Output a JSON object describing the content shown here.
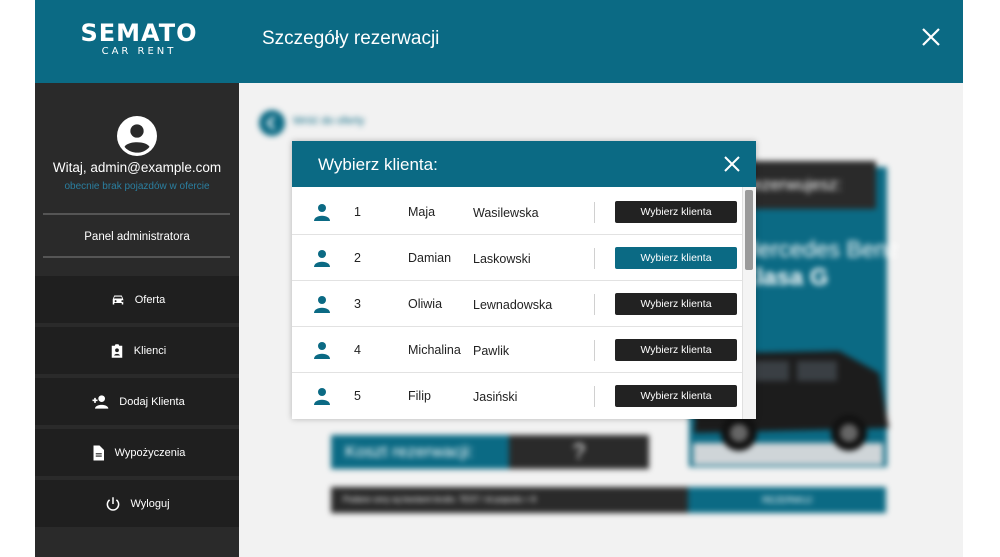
{
  "app": {
    "logo_main": "SEMATO",
    "logo_sub": "CAR RENT",
    "page_title": "Szczegóły rezerwacji"
  },
  "sidebar": {
    "welcome": "Witaj, admin@example.com",
    "no_cars": "obecnie brak pojazdów w ofercie",
    "admin_panel": "Panel administratora",
    "items": [
      {
        "label": "Oferta",
        "icon": "car-icon"
      },
      {
        "label": "Klienci",
        "icon": "id-badge-icon"
      },
      {
        "label": "Dodaj Klienta",
        "icon": "add-user-icon"
      },
      {
        "label": "Wypożyczenia",
        "icon": "document-icon"
      },
      {
        "label": "Wyloguj",
        "icon": "power-icon"
      }
    ]
  },
  "background": {
    "back_link": "Wróć do oferty",
    "selected_label": "Rezerwujesz:",
    "car_brand": "Mercedes Benz",
    "car_model": "Klasa G",
    "cost_label": "Koszt rezerwacji:",
    "cost_value": "?",
    "note": "Podane ceny są kwotami brutto.    TEST / id pojazdu =          8",
    "reserve_button": "REZERWUJ"
  },
  "modal": {
    "title": "Wybierz klienta:",
    "select_label": "Wybierz klienta",
    "clients": [
      {
        "id": "1",
        "first": "Maja",
        "last": "Wasilewska"
      },
      {
        "id": "2",
        "first": "Damian",
        "last": "Laskowski"
      },
      {
        "id": "3",
        "first": "Oliwia",
        "last": "Lewnadowska"
      },
      {
        "id": "4",
        "first": "Michalina",
        "last": "Pawlik"
      },
      {
        "id": "5",
        "first": "Filip",
        "last": "Jasiński"
      }
    ],
    "highlighted_row": "2"
  },
  "colors": {
    "accent": "#0b6a84",
    "sidebar_bg": "#2a2a2a",
    "menu_item_bg": "#1f1f1f",
    "button_dark": "#222222"
  }
}
